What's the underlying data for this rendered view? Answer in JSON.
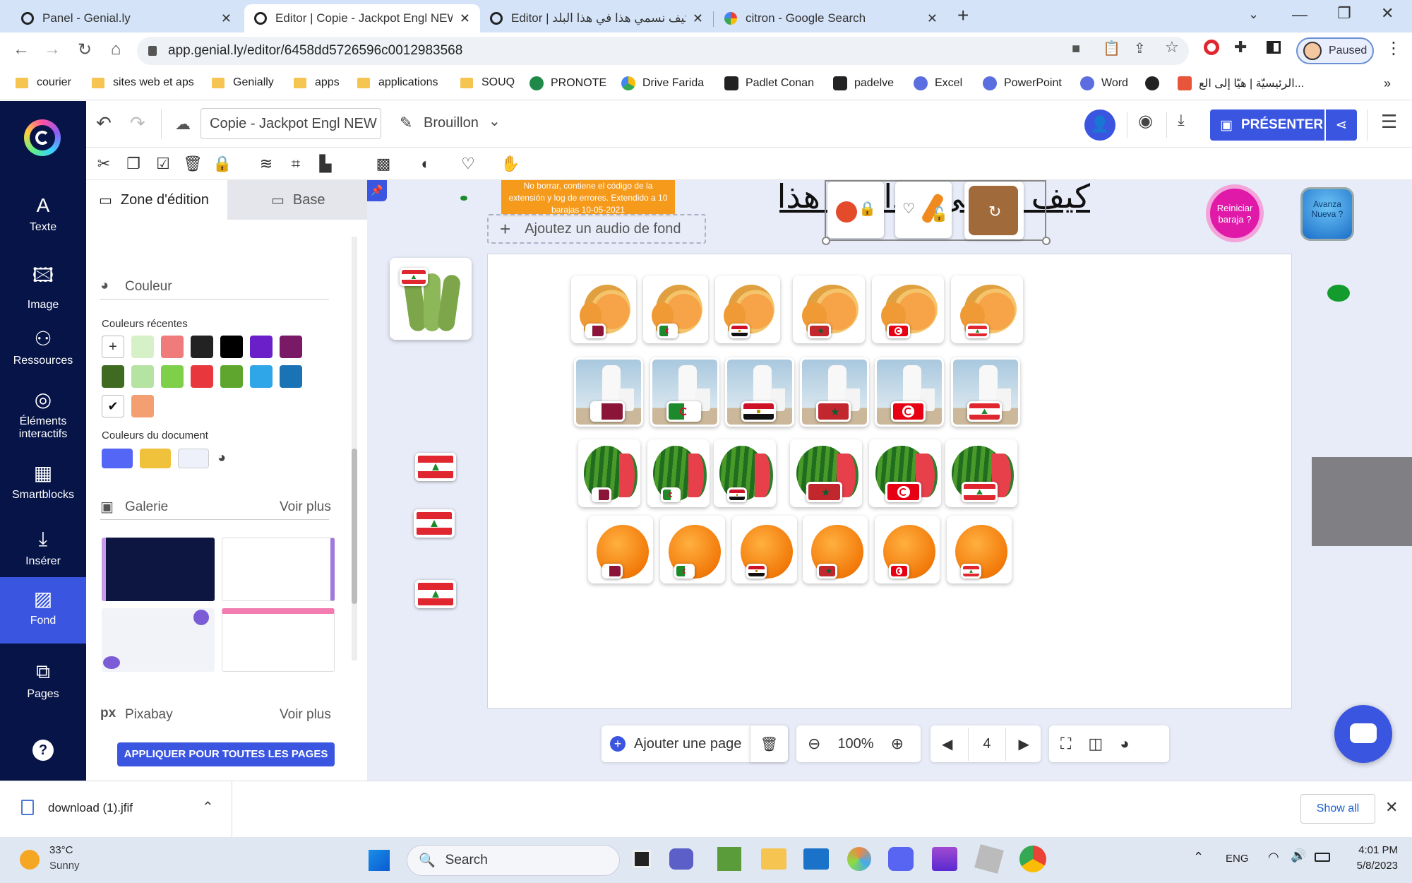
{
  "browser": {
    "tabs": [
      {
        "title": "Panel - Genial.ly",
        "active": false
      },
      {
        "title": "Editor | Copie - Jackpot Engl NEW",
        "active": true
      },
      {
        "title": "Editor | كيف نسمي هذا في هذا البلد",
        "active": false
      },
      {
        "title": "citron - Google Search",
        "active": false
      }
    ],
    "url": "app.genial.ly/editor/6458dd5726596c0012983568",
    "profile_label": "Paused",
    "bookmarks": [
      "courier",
      "sites web et aps",
      "Genially",
      "apps",
      "applications",
      "SOUQ",
      "PRONOTE",
      "Drive Farida",
      "Padlet Conan",
      "padelve",
      "Excel",
      "PowerPoint",
      "Word",
      "الرئيسيّة | هيّا إلى الع..."
    ]
  },
  "sidebar": {
    "items": [
      {
        "label": "Texte",
        "icon": "text-icon"
      },
      {
        "label": "Image",
        "icon": "image-icon"
      },
      {
        "label": "Ressources",
        "icon": "resources-icon"
      },
      {
        "label": "Éléments interactifs",
        "icon": "interactive-icon"
      },
      {
        "label": "Smartblocks",
        "icon": "smartblocks-icon"
      },
      {
        "label": "Insérer",
        "icon": "insert-icon"
      },
      {
        "label": "Fond",
        "icon": "background-icon",
        "active": true
      },
      {
        "label": "Pages",
        "icon": "pages-icon"
      }
    ]
  },
  "topbar": {
    "title": "Copie - Jackpot Engl NEW",
    "status": "Brouillon",
    "present_label": "PRÉSENTER"
  },
  "panel": {
    "tabs": [
      "Zone d'édition",
      "Base"
    ],
    "color_section": "Couleur",
    "recent_colors_label": "Couleurs récentes",
    "recent_colors": [
      "#d6f0c8",
      "#ef7b7b",
      "#222222",
      "#000000",
      "#6a1fc9",
      "#7a1a66",
      "#3e6b1f",
      "#b4e3a2",
      "#7ed04b",
      "#e8383d",
      "#5ea62e",
      "#2ea6e8",
      "#1a73b5",
      "#f39f72"
    ],
    "doc_colors_label": "Couleurs du document",
    "doc_colors": [
      "#5466f5",
      "#f0c23b",
      "#eef1fa"
    ],
    "gallery_label": "Galerie",
    "see_more": "Voir plus",
    "pixabay_label": "Pixabay",
    "apply_label": "APPLIQUER POUR TOUTES LES PAGES"
  },
  "canvas": {
    "audio_label": "Ajoutez un audio de fond",
    "orange_note": "No borrar, contiene el código de la extensión y log de errores. Extendido a 10 barajas 10-05-2021",
    "arabic_title": "كيف نسمي هذا في هذا البلد",
    "reset_label": "Reiniciar baraja ?",
    "advance_label": "Avanza Nueva ?",
    "rows": [
      {
        "item": "melon",
        "flags": [
          "qatar",
          "algeria",
          "egypt",
          "morocco",
          "tunisia",
          "lebanon"
        ]
      },
      {
        "item": "milk",
        "flags": [
          "qatar",
          "algeria",
          "egypt",
          "morocco",
          "tunisia",
          "lebanon"
        ]
      },
      {
        "item": "watermelon",
        "flags": [
          "qatar",
          "algeria",
          "egypt",
          "morocco",
          "tunisia",
          "lebanon"
        ]
      },
      {
        "item": "orange",
        "flags": [
          "qatar",
          "algeria",
          "egypt",
          "morocco",
          "tunisia",
          "lebanon"
        ]
      }
    ]
  },
  "bottombar": {
    "add_page": "Ajouter une page",
    "zoom": "100%",
    "page": "4"
  },
  "downloads": {
    "file": "download (1).jfif",
    "show_all": "Show all"
  },
  "taskbar": {
    "temp": "33°C",
    "weather": "Sunny",
    "search": "Search",
    "lang": "ENG",
    "time": "4:01 PM",
    "date": "5/8/2023"
  }
}
